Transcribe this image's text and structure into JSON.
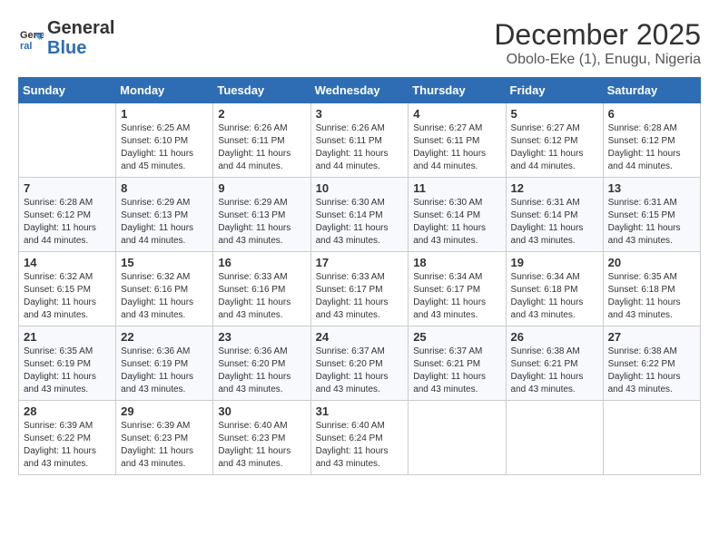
{
  "logo": {
    "general": "General",
    "blue": "Blue"
  },
  "title": "December 2025",
  "location": "Obolo-Eke (1), Enugu, Nigeria",
  "weekdays": [
    "Sunday",
    "Monday",
    "Tuesday",
    "Wednesday",
    "Thursday",
    "Friday",
    "Saturday"
  ],
  "weeks": [
    [
      {
        "day": "",
        "info": ""
      },
      {
        "day": "1",
        "info": "Sunrise: 6:25 AM\nSunset: 6:10 PM\nDaylight: 11 hours\nand 45 minutes."
      },
      {
        "day": "2",
        "info": "Sunrise: 6:26 AM\nSunset: 6:11 PM\nDaylight: 11 hours\nand 44 minutes."
      },
      {
        "day": "3",
        "info": "Sunrise: 6:26 AM\nSunset: 6:11 PM\nDaylight: 11 hours\nand 44 minutes."
      },
      {
        "day": "4",
        "info": "Sunrise: 6:27 AM\nSunset: 6:11 PM\nDaylight: 11 hours\nand 44 minutes."
      },
      {
        "day": "5",
        "info": "Sunrise: 6:27 AM\nSunset: 6:12 PM\nDaylight: 11 hours\nand 44 minutes."
      },
      {
        "day": "6",
        "info": "Sunrise: 6:28 AM\nSunset: 6:12 PM\nDaylight: 11 hours\nand 44 minutes."
      }
    ],
    [
      {
        "day": "7",
        "info": "Sunrise: 6:28 AM\nSunset: 6:12 PM\nDaylight: 11 hours\nand 44 minutes."
      },
      {
        "day": "8",
        "info": "Sunrise: 6:29 AM\nSunset: 6:13 PM\nDaylight: 11 hours\nand 44 minutes."
      },
      {
        "day": "9",
        "info": "Sunrise: 6:29 AM\nSunset: 6:13 PM\nDaylight: 11 hours\nand 43 minutes."
      },
      {
        "day": "10",
        "info": "Sunrise: 6:30 AM\nSunset: 6:14 PM\nDaylight: 11 hours\nand 43 minutes."
      },
      {
        "day": "11",
        "info": "Sunrise: 6:30 AM\nSunset: 6:14 PM\nDaylight: 11 hours\nand 43 minutes."
      },
      {
        "day": "12",
        "info": "Sunrise: 6:31 AM\nSunset: 6:14 PM\nDaylight: 11 hours\nand 43 minutes."
      },
      {
        "day": "13",
        "info": "Sunrise: 6:31 AM\nSunset: 6:15 PM\nDaylight: 11 hours\nand 43 minutes."
      }
    ],
    [
      {
        "day": "14",
        "info": "Sunrise: 6:32 AM\nSunset: 6:15 PM\nDaylight: 11 hours\nand 43 minutes."
      },
      {
        "day": "15",
        "info": "Sunrise: 6:32 AM\nSunset: 6:16 PM\nDaylight: 11 hours\nand 43 minutes."
      },
      {
        "day": "16",
        "info": "Sunrise: 6:33 AM\nSunset: 6:16 PM\nDaylight: 11 hours\nand 43 minutes."
      },
      {
        "day": "17",
        "info": "Sunrise: 6:33 AM\nSunset: 6:17 PM\nDaylight: 11 hours\nand 43 minutes."
      },
      {
        "day": "18",
        "info": "Sunrise: 6:34 AM\nSunset: 6:17 PM\nDaylight: 11 hours\nand 43 minutes."
      },
      {
        "day": "19",
        "info": "Sunrise: 6:34 AM\nSunset: 6:18 PM\nDaylight: 11 hours\nand 43 minutes."
      },
      {
        "day": "20",
        "info": "Sunrise: 6:35 AM\nSunset: 6:18 PM\nDaylight: 11 hours\nand 43 minutes."
      }
    ],
    [
      {
        "day": "21",
        "info": "Sunrise: 6:35 AM\nSunset: 6:19 PM\nDaylight: 11 hours\nand 43 minutes."
      },
      {
        "day": "22",
        "info": "Sunrise: 6:36 AM\nSunset: 6:19 PM\nDaylight: 11 hours\nand 43 minutes."
      },
      {
        "day": "23",
        "info": "Sunrise: 6:36 AM\nSunset: 6:20 PM\nDaylight: 11 hours\nand 43 minutes."
      },
      {
        "day": "24",
        "info": "Sunrise: 6:37 AM\nSunset: 6:20 PM\nDaylight: 11 hours\nand 43 minutes."
      },
      {
        "day": "25",
        "info": "Sunrise: 6:37 AM\nSunset: 6:21 PM\nDaylight: 11 hours\nand 43 minutes."
      },
      {
        "day": "26",
        "info": "Sunrise: 6:38 AM\nSunset: 6:21 PM\nDaylight: 11 hours\nand 43 minutes."
      },
      {
        "day": "27",
        "info": "Sunrise: 6:38 AM\nSunset: 6:22 PM\nDaylight: 11 hours\nand 43 minutes."
      }
    ],
    [
      {
        "day": "28",
        "info": "Sunrise: 6:39 AM\nSunset: 6:22 PM\nDaylight: 11 hours\nand 43 minutes."
      },
      {
        "day": "29",
        "info": "Sunrise: 6:39 AM\nSunset: 6:23 PM\nDaylight: 11 hours\nand 43 minutes."
      },
      {
        "day": "30",
        "info": "Sunrise: 6:40 AM\nSunset: 6:23 PM\nDaylight: 11 hours\nand 43 minutes."
      },
      {
        "day": "31",
        "info": "Sunrise: 6:40 AM\nSunset: 6:24 PM\nDaylight: 11 hours\nand 43 minutes."
      },
      {
        "day": "",
        "info": ""
      },
      {
        "day": "",
        "info": ""
      },
      {
        "day": "",
        "info": ""
      }
    ]
  ]
}
